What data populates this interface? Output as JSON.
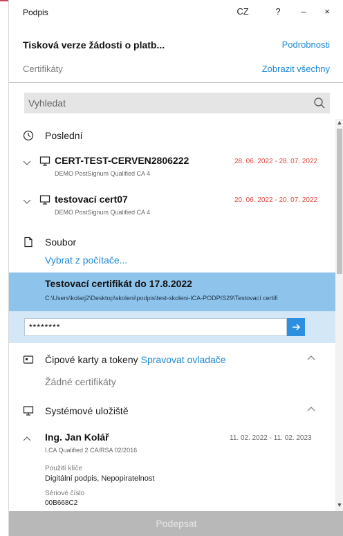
{
  "titlebar": {
    "app_title": "Podpis",
    "lang": "CZ",
    "help": "?",
    "minimize": "–",
    "close": "×"
  },
  "document": {
    "title": "Tisková verze žádosti o platb...",
    "details_link": "Podrobnosti"
  },
  "certificates": {
    "label": "Certifikáty",
    "show_all_link": "Zobrazit všechny"
  },
  "search": {
    "placeholder": "Vyhledat"
  },
  "recent": {
    "label": "Poslední",
    "items": [
      {
        "name": "CERT-TEST-CERVEN2806222",
        "issuer": "DEMO PostSignum Qualified CA 4",
        "validity": "28. 06. 2022 - 28. 07. 2022"
      },
      {
        "name": "testovací cert07",
        "issuer": "DEMO PostSignum Qualified CA 4",
        "validity": "20. 06. 2022 - 20. 07. 2022"
      }
    ]
  },
  "file": {
    "label": "Soubor",
    "choose_link": "Vybrat z počítače...",
    "selected_title": "Testovací certifikát do 17.8.2022",
    "selected_path": "C:\\Users\\kolarj2\\Desktop\\skoleni\\podpis\\test-skoleni-ICA-PODPIS29\\Testovací certifi",
    "password_value": "********"
  },
  "cards": {
    "label": "Čipové karty a tokeny",
    "manage_link": "Spravovat ovladače",
    "empty": "Žádné certifikáty"
  },
  "system": {
    "label": "Systémové uložiště",
    "item": {
      "name": "Ing. Jan Kolář",
      "issuer": "I.CA Qualified 2 CA/RSA 02/2016",
      "validity": "11. 02. 2022 - 11. 02. 2023",
      "key_usage_label": "Použití klíče",
      "key_usage_value": "Digitální podpis, Nepopiratelnost",
      "serial_label": "Sériové číslo",
      "serial_value": "00B668C2"
    }
  },
  "footer": {
    "sign_label": "Podepsat"
  },
  "colors": {
    "accent": "#1e88d6",
    "selected_bg": "#8ec3eb",
    "validity_warning": "#e0453d"
  }
}
